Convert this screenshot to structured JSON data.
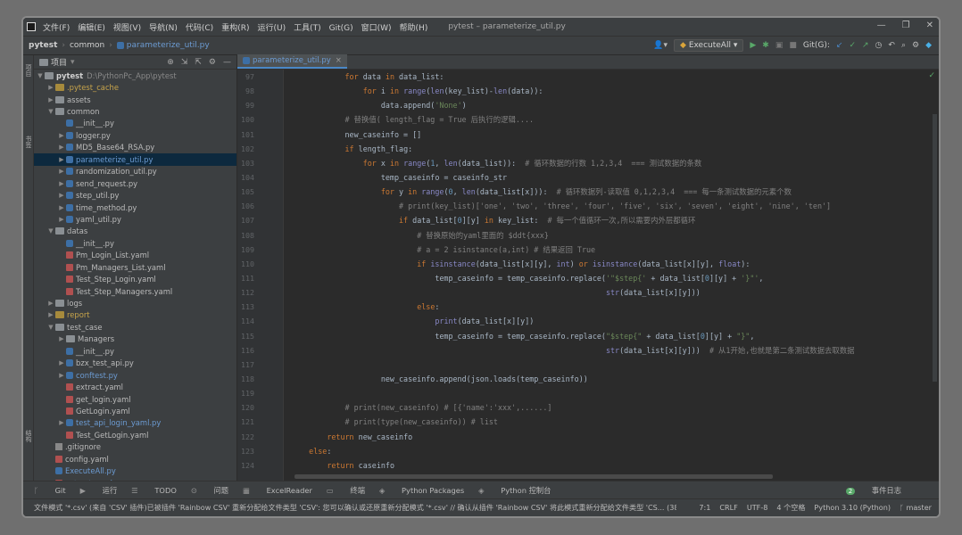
{
  "window": {
    "title": "pytest – parameterize_util.py",
    "menu": [
      "文件(F)",
      "编辑(E)",
      "视图(V)",
      "导航(N)",
      "代码(C)",
      "重构(R)",
      "运行(U)",
      "工具(T)",
      "Git(G)",
      "窗口(W)",
      "帮助(H)"
    ],
    "controls": [
      "—",
      "❐",
      "✕"
    ]
  },
  "navbar": {
    "crumbs": [
      "pytest",
      "common"
    ],
    "file": "parameterize_util.py",
    "run_config": "ExecuteAll",
    "git_label": "Git(G):"
  },
  "project_panel": {
    "title": "项目",
    "root": "pytest",
    "root_path": "D:\\PythonPc_App\\pytest",
    "items": [
      {
        "label": ".pytest_cache",
        "kind": "folder-yellow",
        "depth": 1,
        "arrow": "▶",
        "color": "yel"
      },
      {
        "label": "assets",
        "kind": "folder",
        "depth": 1,
        "arrow": "▶",
        "color": ""
      },
      {
        "label": "common",
        "kind": "folder",
        "depth": 1,
        "arrow": "▼",
        "color": ""
      },
      {
        "label": "__init__.py",
        "kind": "py",
        "depth": 2,
        "arrow": "",
        "color": ""
      },
      {
        "label": "logger.py",
        "kind": "py",
        "depth": 2,
        "arrow": "▶",
        "color": ""
      },
      {
        "label": "MD5_Base64_RSA.py",
        "kind": "py",
        "depth": 2,
        "arrow": "▶",
        "color": ""
      },
      {
        "label": "parameterize_util.py",
        "kind": "py",
        "depth": 2,
        "arrow": "▶",
        "color": "blue",
        "selected": true
      },
      {
        "label": "randomization_util.py",
        "kind": "py",
        "depth": 2,
        "arrow": "▶",
        "color": ""
      },
      {
        "label": "send_request.py",
        "kind": "py",
        "depth": 2,
        "arrow": "▶",
        "color": ""
      },
      {
        "label": "step_util.py",
        "kind": "py",
        "depth": 2,
        "arrow": "▶",
        "color": ""
      },
      {
        "label": "time_method.py",
        "kind": "py",
        "depth": 2,
        "arrow": "▶",
        "color": ""
      },
      {
        "label": "yaml_util.py",
        "kind": "py",
        "depth": 2,
        "arrow": "▶",
        "color": ""
      },
      {
        "label": "datas",
        "kind": "folder",
        "depth": 1,
        "arrow": "▼",
        "color": ""
      },
      {
        "label": "__init__.py",
        "kind": "py",
        "depth": 2,
        "arrow": "",
        "color": ""
      },
      {
        "label": "Pm_Login_List.yaml",
        "kind": "yaml",
        "depth": 2,
        "arrow": "",
        "color": ""
      },
      {
        "label": "Pm_Managers_List.yaml",
        "kind": "yaml",
        "depth": 2,
        "arrow": "",
        "color": ""
      },
      {
        "label": "Test_Step_Login.yaml",
        "kind": "yaml",
        "depth": 2,
        "arrow": "",
        "color": ""
      },
      {
        "label": "Test_Step_Managers.yaml",
        "kind": "yaml",
        "depth": 2,
        "arrow": "",
        "color": ""
      },
      {
        "label": "logs",
        "kind": "folder",
        "depth": 1,
        "arrow": "▶",
        "color": ""
      },
      {
        "label": "report",
        "kind": "folder-yellow",
        "depth": 1,
        "arrow": "▶",
        "color": "yel"
      },
      {
        "label": "test_case",
        "kind": "folder",
        "depth": 1,
        "arrow": "▼",
        "color": ""
      },
      {
        "label": "Managers",
        "kind": "folder",
        "depth": 2,
        "arrow": "▶",
        "color": ""
      },
      {
        "label": "__init__.py",
        "kind": "py",
        "depth": 2,
        "arrow": "",
        "color": ""
      },
      {
        "label": "bzx_test_api.py",
        "kind": "py",
        "depth": 2,
        "arrow": "▶",
        "color": ""
      },
      {
        "label": "conftest.py",
        "kind": "py",
        "depth": 2,
        "arrow": "▶",
        "color": "blue"
      },
      {
        "label": "extract.yaml",
        "kind": "yaml",
        "depth": 2,
        "arrow": "",
        "color": ""
      },
      {
        "label": "get_login.yaml",
        "kind": "yaml",
        "depth": 2,
        "arrow": "",
        "color": ""
      },
      {
        "label": "GetLogin.yaml",
        "kind": "yaml",
        "depth": 2,
        "arrow": "",
        "color": ""
      },
      {
        "label": "test_api_login_yaml.py",
        "kind": "py",
        "depth": 2,
        "arrow": "▶",
        "color": "blue"
      },
      {
        "label": "Test_GetLogin.yaml",
        "kind": "yaml",
        "depth": 2,
        "arrow": "",
        "color": ""
      },
      {
        "label": ".gitignore",
        "kind": "txt",
        "depth": 1,
        "arrow": "",
        "color": ""
      },
      {
        "label": "config.yaml",
        "kind": "yaml",
        "depth": 1,
        "arrow": "",
        "color": ""
      },
      {
        "label": "ExecuteAll.py",
        "kind": "py",
        "depth": 1,
        "arrow": "",
        "color": "blue"
      },
      {
        "label": "extract.yaml",
        "kind": "yaml",
        "depth": 1,
        "arrow": "",
        "color": "blue"
      }
    ]
  },
  "editor": {
    "tab": "parameterize_util.py",
    "line_numbers": [
      "97",
      "98",
      "99",
      "100",
      "101",
      "102",
      "103",
      "104",
      "105",
      "106",
      "107",
      "108",
      "109",
      "110",
      "111",
      "112",
      "113",
      "114",
      "115",
      "116",
      "117",
      "118",
      "119",
      "120",
      "121",
      "122",
      "123",
      "124"
    ],
    "code_lines": [
      [
        {
          "t": "            ",
          "c": ""
        },
        {
          "t": "for",
          "c": "kw"
        },
        {
          "t": " data ",
          "c": ""
        },
        {
          "t": "in",
          "c": "kw"
        },
        {
          "t": " data_list:",
          "c": ""
        }
      ],
      [
        {
          "t": "                ",
          "c": ""
        },
        {
          "t": "for",
          "c": "kw"
        },
        {
          "t": " i ",
          "c": ""
        },
        {
          "t": "in",
          "c": "kw"
        },
        {
          "t": " ",
          "c": ""
        },
        {
          "t": "range",
          "c": "bi"
        },
        {
          "t": "(",
          "c": ""
        },
        {
          "t": "len",
          "c": "bi"
        },
        {
          "t": "(key_list)-",
          "c": ""
        },
        {
          "t": "len",
          "c": "bi"
        },
        {
          "t": "(data)):",
          "c": ""
        }
      ],
      [
        {
          "t": "                    data.append(",
          "c": ""
        },
        {
          "t": "'None'",
          "c": "str"
        },
        {
          "t": ")",
          "c": ""
        }
      ],
      [
        {
          "t": "            ",
          "c": ""
        },
        {
          "t": "# 替换值( length_flag = True 后执行的逻辑....",
          "c": "cm"
        }
      ],
      [
        {
          "t": "            new_caseinfo = []",
          "c": ""
        }
      ],
      [
        {
          "t": "            ",
          "c": ""
        },
        {
          "t": "if",
          "c": "kw"
        },
        {
          "t": " length_flag:",
          "c": ""
        }
      ],
      [
        {
          "t": "                ",
          "c": ""
        },
        {
          "t": "for",
          "c": "kw"
        },
        {
          "t": " x ",
          "c": ""
        },
        {
          "t": "in",
          "c": "kw"
        },
        {
          "t": " ",
          "c": ""
        },
        {
          "t": "range",
          "c": "bi"
        },
        {
          "t": "(",
          "c": ""
        },
        {
          "t": "1",
          "c": "num"
        },
        {
          "t": ", ",
          "c": ""
        },
        {
          "t": "len",
          "c": "bi"
        },
        {
          "t": "(data_list)):  ",
          "c": ""
        },
        {
          "t": "# 循环数据的行数 1,2,3,4  === 测试数据的条数",
          "c": "cm"
        }
      ],
      [
        {
          "t": "                    temp_caseinfo = caseinfo_str",
          "c": ""
        }
      ],
      [
        {
          "t": "                    ",
          "c": ""
        },
        {
          "t": "for",
          "c": "kw"
        },
        {
          "t": " y ",
          "c": ""
        },
        {
          "t": "in",
          "c": "kw"
        },
        {
          "t": " ",
          "c": ""
        },
        {
          "t": "range",
          "c": "bi"
        },
        {
          "t": "(",
          "c": ""
        },
        {
          "t": "0",
          "c": "num"
        },
        {
          "t": ", ",
          "c": ""
        },
        {
          "t": "len",
          "c": "bi"
        },
        {
          "t": "(data_list[x])):  ",
          "c": ""
        },
        {
          "t": "# 循环数据列-读取值 0,1,2,3,4  === 每一条测试数据的元素个数",
          "c": "cm"
        }
      ],
      [
        {
          "t": "                        ",
          "c": ""
        },
        {
          "t": "# print(key_list)['one', 'two', 'three', 'four', 'five', 'six', 'seven', 'eight', 'nine', 'ten']",
          "c": "cm"
        }
      ],
      [
        {
          "t": "                        ",
          "c": ""
        },
        {
          "t": "if",
          "c": "kw"
        },
        {
          "t": " data_list[",
          "c": ""
        },
        {
          "t": "0",
          "c": "num"
        },
        {
          "t": "][y] ",
          "c": ""
        },
        {
          "t": "in",
          "c": "kw"
        },
        {
          "t": " key_list:  ",
          "c": ""
        },
        {
          "t": "# 每一个值循环一次,所以需要内外层都循环",
          "c": "cm"
        }
      ],
      [
        {
          "t": "                            ",
          "c": ""
        },
        {
          "t": "# 替换原始的yaml里面的 $ddt{xxx}",
          "c": "cm"
        }
      ],
      [
        {
          "t": "                            ",
          "c": ""
        },
        {
          "t": "# a = 2 isinstance(a,int) # 结果返回 True",
          "c": "cm"
        }
      ],
      [
        {
          "t": "                            ",
          "c": ""
        },
        {
          "t": "if",
          "c": "kw"
        },
        {
          "t": " ",
          "c": ""
        },
        {
          "t": "isinstance",
          "c": "bi"
        },
        {
          "t": "(data_list[x][y], ",
          "c": ""
        },
        {
          "t": "int",
          "c": "bi"
        },
        {
          "t": ") ",
          "c": ""
        },
        {
          "t": "or",
          "c": "kw"
        },
        {
          "t": " ",
          "c": ""
        },
        {
          "t": "isinstance",
          "c": "bi"
        },
        {
          "t": "(data_list[x][y], ",
          "c": ""
        },
        {
          "t": "float",
          "c": "bi"
        },
        {
          "t": "):",
          "c": ""
        }
      ],
      [
        {
          "t": "                                temp_caseinfo = temp_caseinfo.replace(",
          "c": ""
        },
        {
          "t": "'\"$step{' ",
          "c": "str"
        },
        {
          "t": "+ data_list[",
          "c": ""
        },
        {
          "t": "0",
          "c": "num"
        },
        {
          "t": "][y] + ",
          "c": ""
        },
        {
          "t": "'}\"'",
          "c": "str"
        },
        {
          "t": ",",
          "c": ""
        }
      ],
      [
        {
          "t": "                                                                      ",
          "c": ""
        },
        {
          "t": "str",
          "c": "bi"
        },
        {
          "t": "(data_list[x][y]))",
          "c": ""
        }
      ],
      [
        {
          "t": "                            ",
          "c": ""
        },
        {
          "t": "else",
          "c": "kw"
        },
        {
          "t": ":",
          "c": ""
        }
      ],
      [
        {
          "t": "                                ",
          "c": ""
        },
        {
          "t": "print",
          "c": "bi"
        },
        {
          "t": "(data_list[x][y])",
          "c": ""
        }
      ],
      [
        {
          "t": "                                temp_caseinfo = temp_caseinfo.replace(",
          "c": ""
        },
        {
          "t": "\"$step{\" ",
          "c": "str"
        },
        {
          "t": "+ data_list[",
          "c": ""
        },
        {
          "t": "0",
          "c": "num"
        },
        {
          "t": "][y] + ",
          "c": ""
        },
        {
          "t": "\"}\"",
          "c": "str"
        },
        {
          "t": ",",
          "c": ""
        }
      ],
      [
        {
          "t": "                                                                      ",
          "c": ""
        },
        {
          "t": "str",
          "c": "bi"
        },
        {
          "t": "(data_list[x][y]))  ",
          "c": ""
        },
        {
          "t": "# 从1开始,也就是第二条测试数据去取数据",
          "c": "cm"
        }
      ],
      [
        {
          "t": "",
          "c": ""
        }
      ],
      [
        {
          "t": "                    new_caseinfo.append(json.loads(temp_caseinfo))",
          "c": ""
        }
      ],
      [
        {
          "t": "",
          "c": ""
        }
      ],
      [
        {
          "t": "            ",
          "c": ""
        },
        {
          "t": "# print(new_caseinfo) # [{'name':'xxx',......]",
          "c": "cm"
        }
      ],
      [
        {
          "t": "            ",
          "c": ""
        },
        {
          "t": "# print(type(new_caseinfo)) # list",
          "c": "cm"
        }
      ],
      [
        {
          "t": "        ",
          "c": ""
        },
        {
          "t": "return",
          "c": "kw"
        },
        {
          "t": " new_caseinfo",
          "c": ""
        }
      ],
      [
        {
          "t": "    ",
          "c": ""
        },
        {
          "t": "else",
          "c": "kw"
        },
        {
          "t": ":",
          "c": ""
        }
      ],
      [
        {
          "t": "        ",
          "c": ""
        },
        {
          "t": "return",
          "c": "kw"
        },
        {
          "t": " caseinfo",
          "c": ""
        }
      ]
    ]
  },
  "left_strip": [
    "项目",
    "书签",
    "结构"
  ],
  "toolwindows": [
    "Git",
    "运行",
    "TODO",
    "问题",
    "ExcelReader",
    "终端",
    "Python Packages",
    "Python 控制台"
  ],
  "event_log": "事件日志",
  "status": {
    "message": "文件模式 '*.csv' (来自 'CSV' 插件)已被插件 'Rainbow CSV' 重新分配给文件类型 'CSV': 您可以确认或还原重新分配模式 '*.csv' // 确认从插件 'Rainbow CSV' 将此模式重新分配给文件类型 'CS... (38 分钟 之前)",
    "position": "7:1",
    "line_sep": "CRLF",
    "encoding": "UTF-8",
    "indent": "4 个空格",
    "interpreter": "Python 3.10 (Python)",
    "branch": "master"
  }
}
